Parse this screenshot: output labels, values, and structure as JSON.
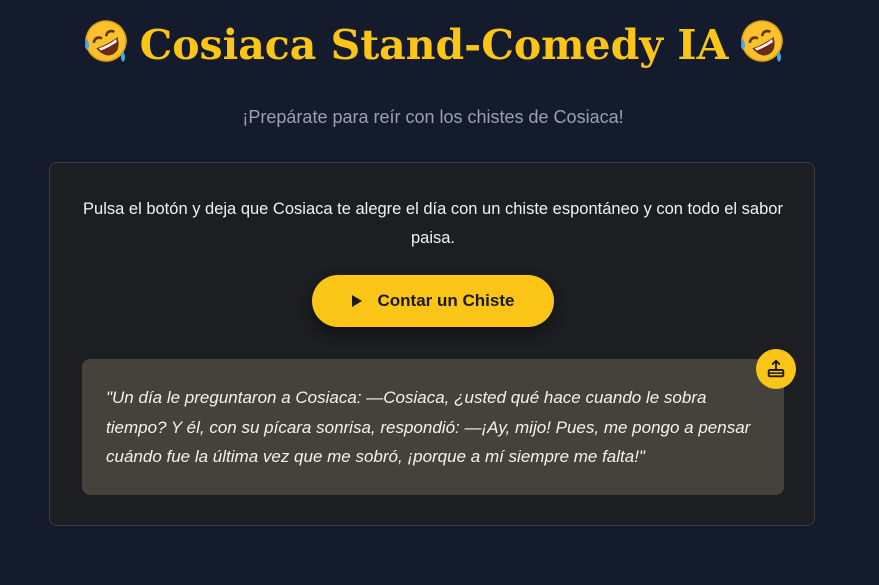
{
  "header": {
    "emoji_left": "🤣",
    "title": "Cosiaca Stand-Comedy IA",
    "emoji_right": "🤣",
    "subtitle": "¡Prepárate para reír con los chistes de Cosiaca!"
  },
  "card": {
    "intro": "Pulsa el botón y deja que Cosiaca te alegre el día con un chiste espontáneo y con todo el sabor paisa.",
    "button_label": "Contar un Chiste",
    "button_icon": "play-icon",
    "joke": "\"Un día le preguntaron a Cosiaca: —Cosiaca, ¿usted qué hace cuando le sobra tiempo? Y él, con su pícara sonrisa, respondió: —¡Ay, mijo! Pues, me pongo a pensar cuándo fue la última vez que me sobró, ¡porque a mí siempre me falta!\"",
    "share_icon": "share-icon"
  },
  "colors": {
    "background": "#141b2d",
    "accent": "#fac517",
    "card": "#1c1e22",
    "joke_box": "#45423c",
    "subtitle": "#9aa1ad"
  }
}
